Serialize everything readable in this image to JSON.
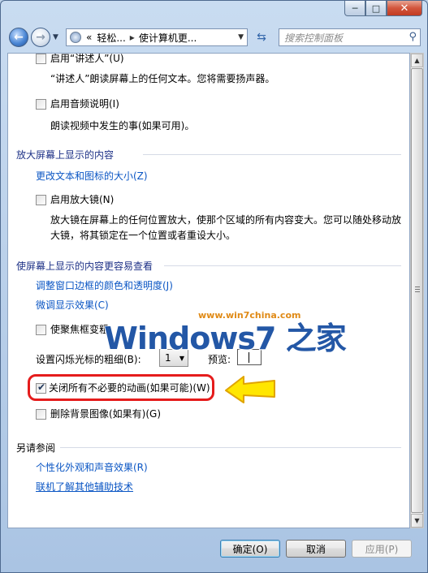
{
  "window": {
    "caption_buttons": {
      "minimize": "─",
      "maximize": "□",
      "close": "✕"
    }
  },
  "nav": {
    "back_icon": "arrow-left",
    "forward_icon": "arrow-right",
    "breadcrumb": [
      "«",
      "轻松...",
      "使计算机更..."
    ],
    "search_placeholder": "搜索控制面板"
  },
  "sections": {
    "narrator": {
      "label": "启用“讲述人”(U)",
      "desc": "“讲述人”朗读屏幕上的任何文本。您将需要扬声器。"
    },
    "audio_desc": {
      "label": "启用音频说明(I)",
      "desc": "朗读视频中发生的事(如果可用)。"
    },
    "magnify": {
      "title": "放大屏幕上显示的内容",
      "link": "更改文本和图标的大小(Z)",
      "checkbox_label": "启用放大镜(N)",
      "desc": "放大镜在屏幕上的任何位置放大，使那个区域的所有内容变大。您可以随处移动放大镜，将其锁定在一个位置或者重设大小。"
    },
    "easier_view": {
      "title": "使屏幕上显示的内容更容易查看",
      "link1": "调整窗口边框的颜色和透明度(J)",
      "link2": "微调显示效果(C)",
      "focus_label": "使聚焦框变粗",
      "cursor_label": "设置闪烁光标的粗细(B):",
      "cursor_value": "1",
      "preview_label": "预览:",
      "animations_label": "关闭所有不必要的动画(如果可能)(W)",
      "animations_checked": true,
      "background_label": "删除背景图像(如果有)(G)"
    },
    "see_also": {
      "title": "另请参阅",
      "link1": "个性化外观和声音效果(R)",
      "link2": "联机了解其他辅助技术"
    }
  },
  "watermark": {
    "url": "www.win7china.com",
    "title": "Windows7 之家"
  },
  "annotation": {
    "highlight_color": "#e51c1c",
    "arrow_color": "#ffe600"
  },
  "footer": {
    "ok": "确定(O)",
    "cancel": "取消",
    "apply": "应用(P)"
  }
}
